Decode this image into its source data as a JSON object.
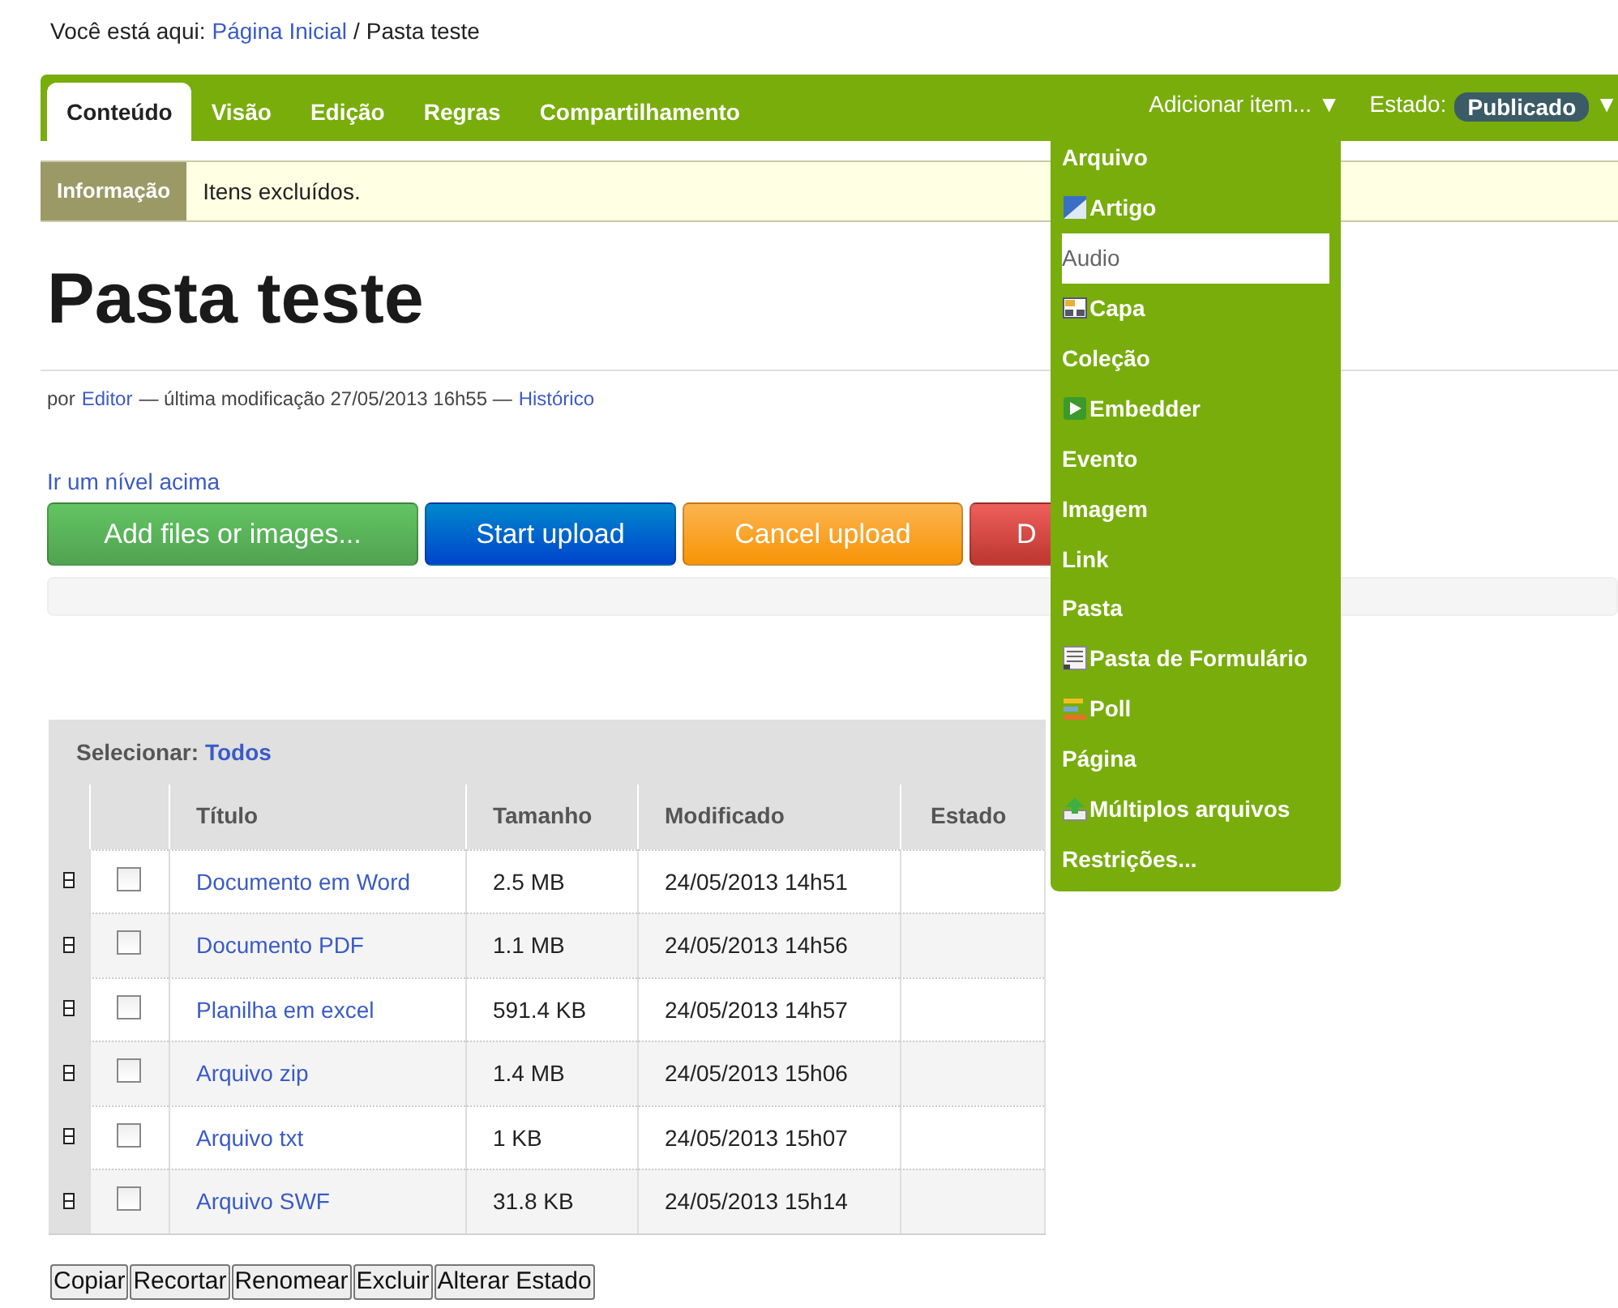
{
  "breadcrumb": {
    "label": "Você está aqui:",
    "links": [
      "Página Inicial"
    ],
    "separator": "/",
    "current": "Pasta teste"
  },
  "tabs": [
    {
      "label": "Conteúdo",
      "selected": true
    },
    {
      "label": "Visão",
      "selected": false
    },
    {
      "label": "Edição",
      "selected": false
    },
    {
      "label": "Regras",
      "selected": false
    },
    {
      "label": "Compartilhamento",
      "selected": false
    }
  ],
  "add_menu": {
    "label": "Adicionar item...",
    "arrow": "▼",
    "expanded": true,
    "items": [
      {
        "label": "Arquivo",
        "kind": "plain",
        "selected": false
      },
      {
        "label": "Artigo",
        "kind": "article",
        "selected": false
      },
      {
        "label": "Audio",
        "kind": "plain",
        "selected": true
      },
      {
        "label": "Capa",
        "kind": "layout",
        "selected": false
      },
      {
        "label": "Coleção",
        "kind": "plain",
        "selected": false
      },
      {
        "label": "Embedder",
        "kind": "play",
        "selected": false
      },
      {
        "label": "Evento",
        "kind": "plain",
        "selected": false
      },
      {
        "label": "Imagem",
        "kind": "plain",
        "selected": false
      },
      {
        "label": "Link",
        "kind": "plain",
        "selected": false
      },
      {
        "label": "Pasta",
        "kind": "plain",
        "selected": false
      },
      {
        "label": "Pasta de Formulário",
        "kind": "form",
        "selected": false
      },
      {
        "label": "Poll",
        "kind": "poll",
        "selected": false
      },
      {
        "label": "Página",
        "kind": "plain",
        "selected": false
      },
      {
        "label": "Múltiplos arquivos",
        "kind": "upload",
        "selected": false
      },
      {
        "label": "Restrições...",
        "kind": "plain",
        "selected": false
      }
    ]
  },
  "state_menu": {
    "label": "Estado:",
    "value": "Publicado",
    "arrow": "▼"
  },
  "message": {
    "label": "Informação",
    "text": "Itens excluídos."
  },
  "title": "Pasta teste",
  "byline": {
    "prefix": "por",
    "author": "Editor",
    "modified": "— última modificação 27/05/2013 16h55 —",
    "history": "Histórico"
  },
  "up_link": "Ir um nível acima",
  "upload_buttons": [
    {
      "label": "Add files or images...",
      "kind": "add"
    },
    {
      "label": "Start upload",
      "kind": "start"
    },
    {
      "label": "Cancel upload",
      "kind": "cancel"
    },
    {
      "label": "D",
      "kind": "delete"
    }
  ],
  "table": {
    "select_label": "Selecionar:",
    "select_all": "Todos",
    "columns": [
      "Título",
      "Tamanho",
      "Modificado",
      "Estado"
    ],
    "rows": [
      {
        "title": "Documento em Word",
        "size": "2.5 MB",
        "modified": "24/05/2013 14h51",
        "checked": false
      },
      {
        "title": "Documento PDF",
        "size": "1.1 MB",
        "modified": "24/05/2013 14h56",
        "checked": false
      },
      {
        "title": "Planilha em excel",
        "size": "591.4 KB",
        "modified": "24/05/2013 14h57",
        "checked": false
      },
      {
        "title": "Arquivo zip",
        "size": "1.4 MB",
        "modified": "24/05/2013 15h06",
        "checked": false
      },
      {
        "title": "Arquivo txt",
        "size": "1 KB",
        "modified": "24/05/2013 15h07",
        "checked": false
      },
      {
        "title": "Arquivo SWF",
        "size": "31.8 KB",
        "modified": "24/05/2013 15h14",
        "checked": false
      }
    ]
  },
  "actions": [
    "Copiar",
    "Recortar",
    "Renomear",
    "Excluir",
    "Alterar Estado"
  ]
}
